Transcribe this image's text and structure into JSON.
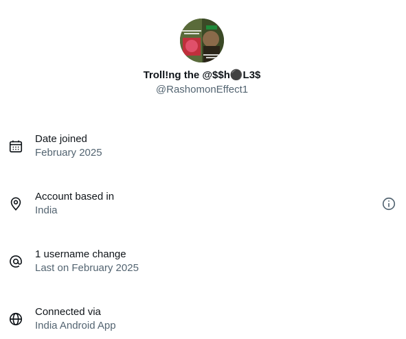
{
  "profile": {
    "display_name": "Troll!ng the @$$h⚫️L3$",
    "handle": "@RashomonEffect1"
  },
  "rows": [
    {
      "icon": "calendar-icon",
      "title": "Date joined",
      "subtitle": "February 2025"
    },
    {
      "icon": "location-pin-icon",
      "title": "Account based in",
      "subtitle": "India",
      "trailing_icon": "info-icon"
    },
    {
      "icon": "at-sign-icon",
      "title": "1 username change",
      "subtitle": "Last on February 2025"
    },
    {
      "icon": "globe-icon",
      "title": "Connected via",
      "subtitle": "India Android App"
    }
  ],
  "colors": {
    "primary_text": "#0f1419",
    "secondary_text": "#536471"
  }
}
